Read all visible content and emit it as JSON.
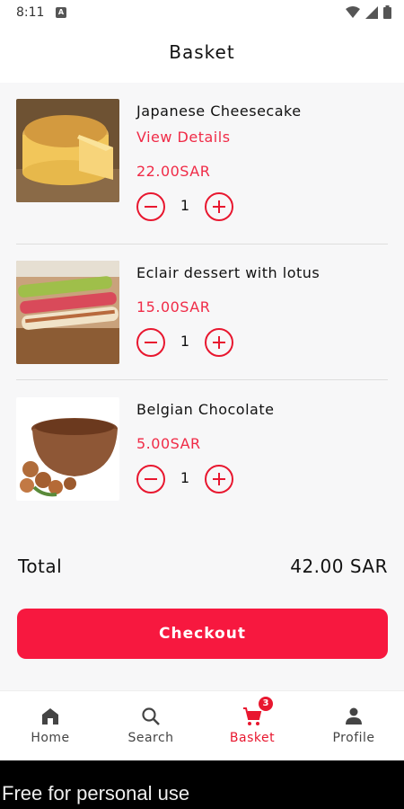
{
  "status_bar": {
    "time": "8:11",
    "notif_icon": "a-notification-icon",
    "icons": [
      "wifi-icon",
      "signal-icon",
      "battery-icon"
    ]
  },
  "header": {
    "title": "Basket"
  },
  "items": [
    {
      "name": "Japanese Cheesecake",
      "view_details": "View Details",
      "price": "22.00SAR",
      "quantity": "1",
      "image": "cheesecake-image"
    },
    {
      "name": "Eclair dessert with lotus",
      "price": "15.00SAR",
      "quantity": "1",
      "image": "eclair-image"
    },
    {
      "name": "Belgian Chocolate",
      "price": "5.00SAR",
      "quantity": "1",
      "image": "chocolate-image"
    }
  ],
  "summary": {
    "total_label": "Total",
    "total_value": "42.00 SAR"
  },
  "checkout": {
    "label": "Checkout"
  },
  "nav": {
    "items": [
      {
        "label": "Home",
        "icon": "home-icon"
      },
      {
        "label": "Search",
        "icon": "search-icon"
      },
      {
        "label": "Basket",
        "icon": "cart-icon",
        "badge": "3",
        "active": true
      },
      {
        "label": "Profile",
        "icon": "person-icon"
      }
    ]
  },
  "watermark": {
    "text": "Free for personal use"
  },
  "colors": {
    "accent": "#f7183f",
    "text": "#111111",
    "background": "#f7f7f8"
  }
}
